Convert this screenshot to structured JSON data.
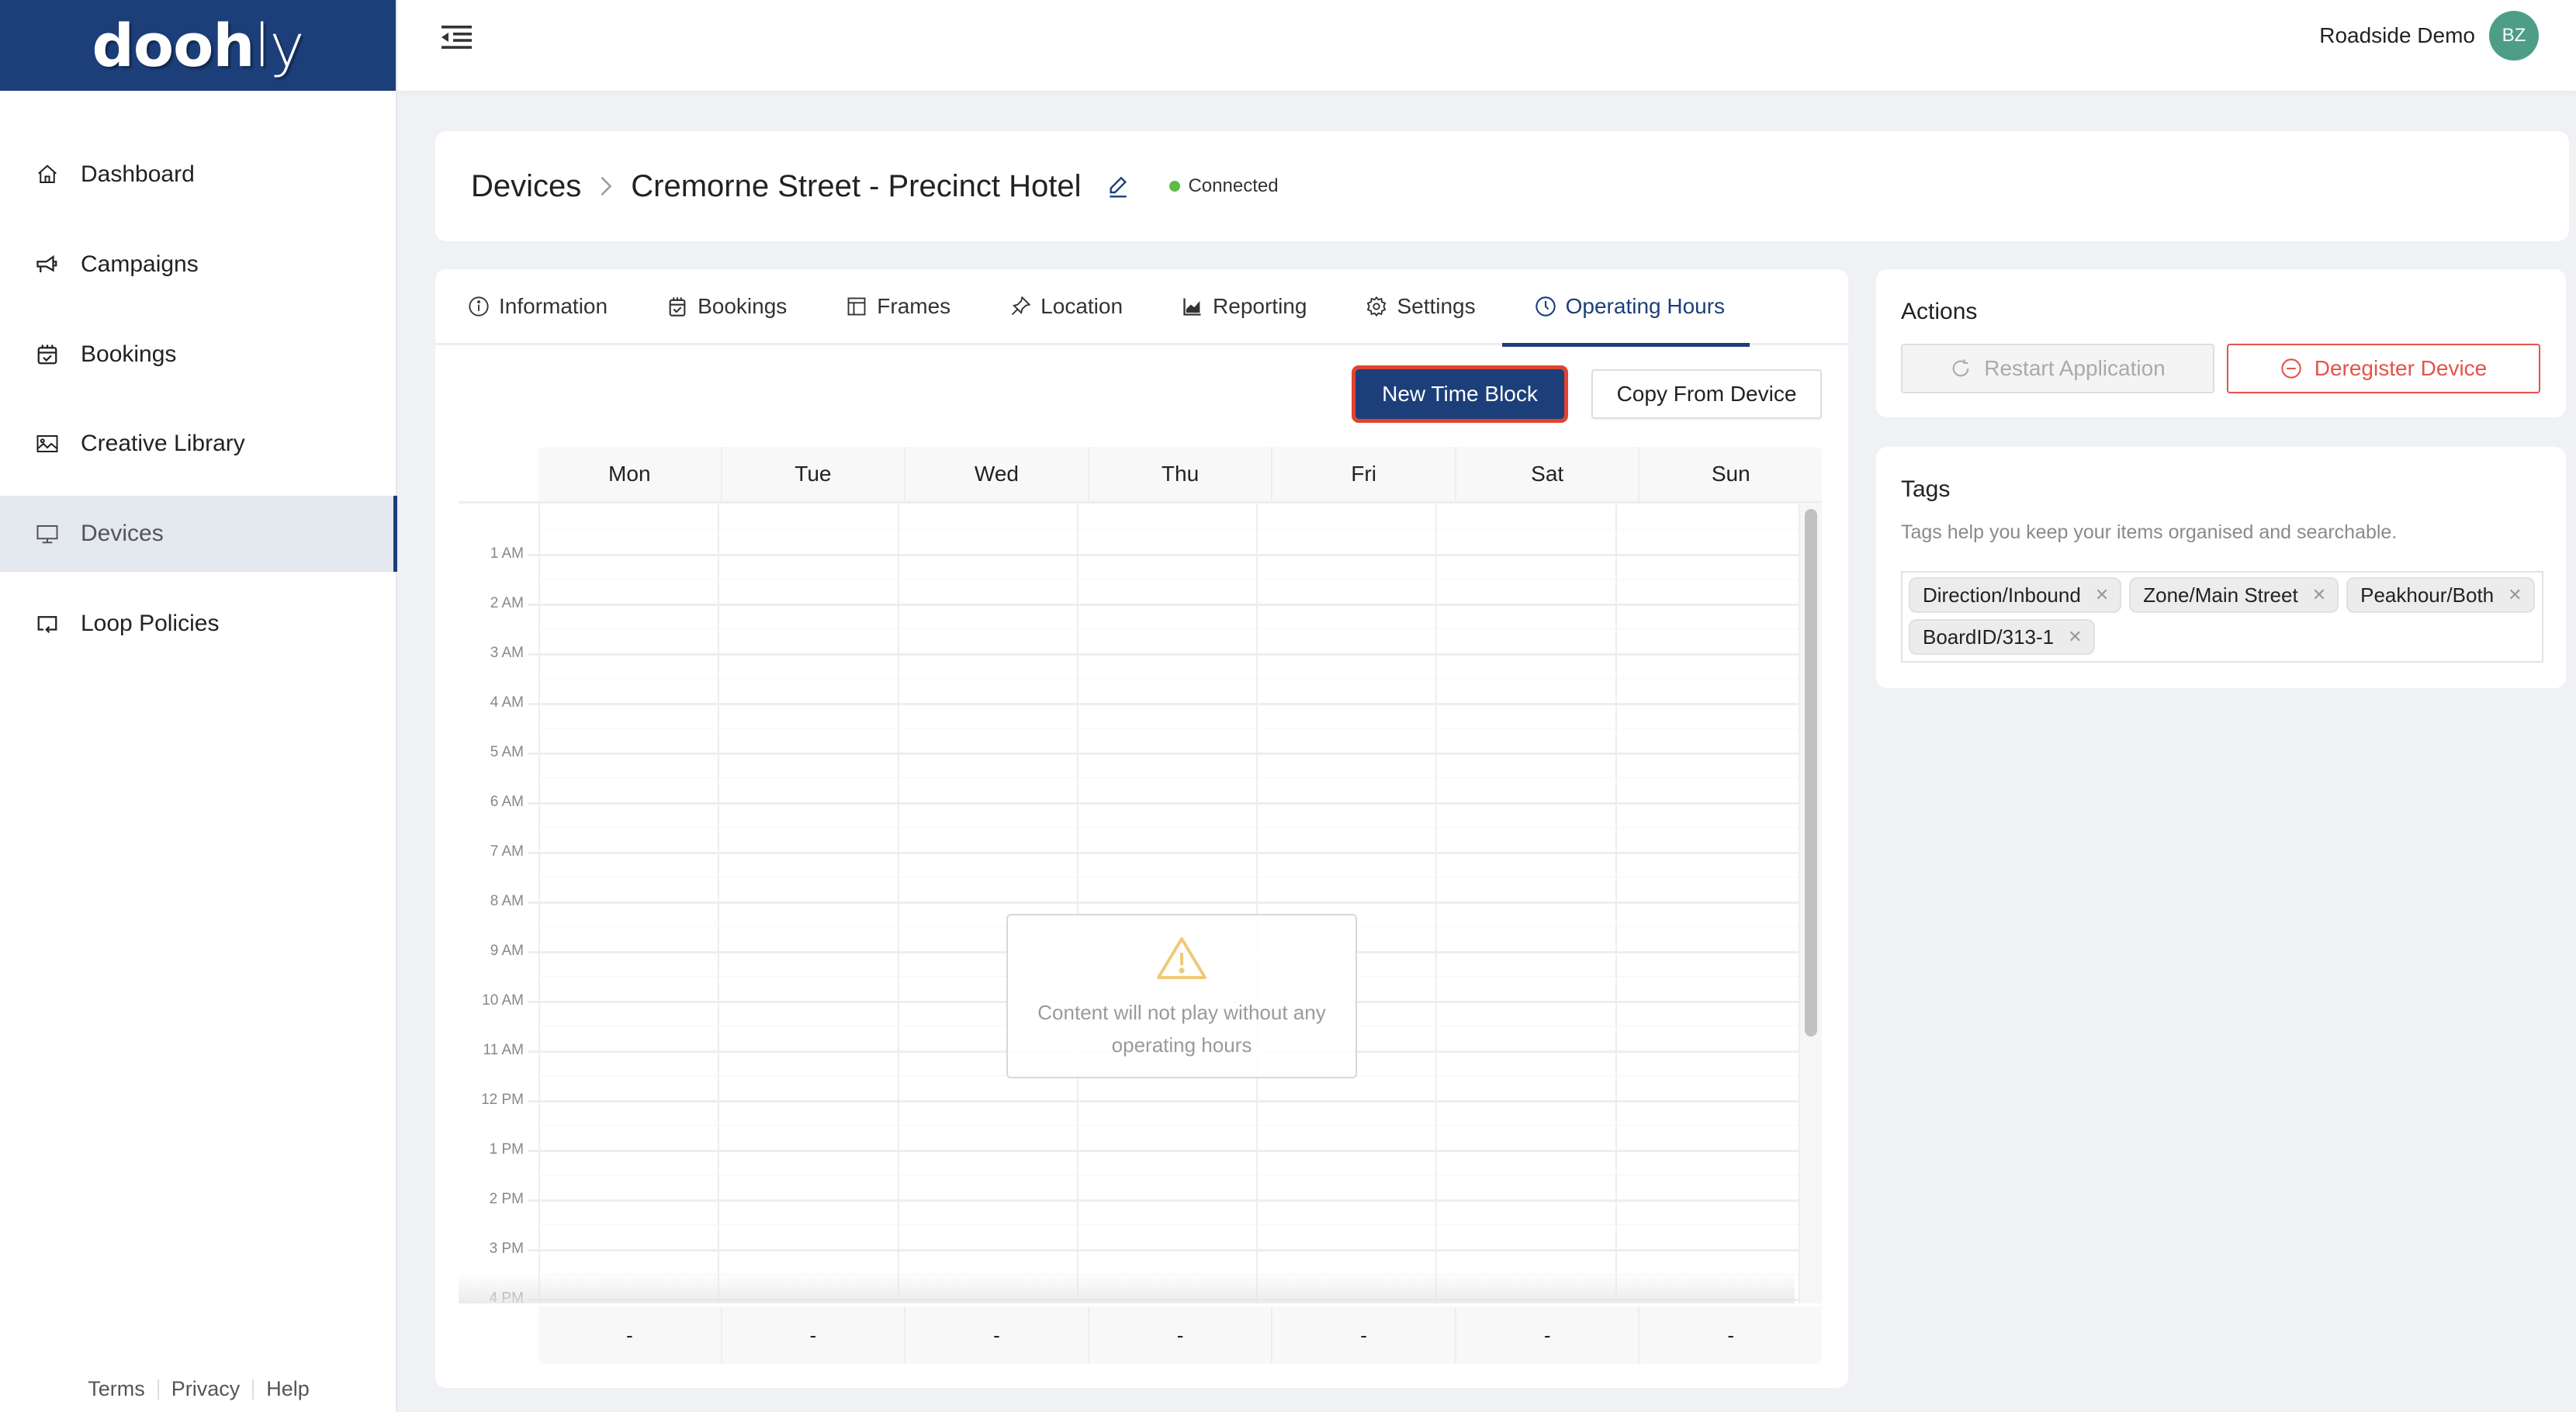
{
  "app": {
    "logo_bold": "dooh",
    "logo_light": "ly"
  },
  "sidebar": {
    "items": [
      {
        "label": "Dashboard",
        "icon": "home-icon",
        "active": false
      },
      {
        "label": "Campaigns",
        "icon": "megaphone-icon",
        "active": false
      },
      {
        "label": "Bookings",
        "icon": "calendar-check-icon",
        "active": false
      },
      {
        "label": "Creative Library",
        "icon": "image-icon",
        "active": false
      },
      {
        "label": "Devices",
        "icon": "monitor-icon",
        "active": true
      },
      {
        "label": "Loop Policies",
        "icon": "loop-icon",
        "active": false
      }
    ],
    "footer": {
      "terms": "Terms",
      "privacy": "Privacy",
      "help": "Help"
    }
  },
  "header": {
    "user_name": "Roadside Demo",
    "avatar_initials": "BZ",
    "avatar_color": "#4e9e87"
  },
  "page": {
    "breadcrumb_root": "Devices",
    "device_name": "Cremorne Street - Precinct Hotel",
    "status": "Connected",
    "status_color": "#5dbb46"
  },
  "tabs": [
    {
      "label": "Information",
      "icon": "info-icon",
      "active": false
    },
    {
      "label": "Bookings",
      "icon": "calendar-check-icon",
      "active": false
    },
    {
      "label": "Frames",
      "icon": "frames-icon",
      "active": false
    },
    {
      "label": "Location",
      "icon": "pin-icon",
      "active": false
    },
    {
      "label": "Reporting",
      "icon": "chart-icon",
      "active": false
    },
    {
      "label": "Settings",
      "icon": "gear-icon",
      "active": false
    },
    {
      "label": "Operating Hours",
      "icon": "clock-icon",
      "active": true
    }
  ],
  "toolbar": {
    "new_time_block": "New Time Block",
    "copy_from_device": "Copy From Device"
  },
  "calendar": {
    "days": [
      "Mon",
      "Tue",
      "Wed",
      "Thu",
      "Fri",
      "Sat",
      "Sun"
    ],
    "hours": [
      "1 AM",
      "2 AM",
      "3 AM",
      "4 AM",
      "5 AM",
      "6 AM",
      "7 AM",
      "8 AM",
      "9 AM",
      "10 AM",
      "11 AM",
      "12 PM",
      "1 PM",
      "2 PM",
      "3 PM",
      "4 PM"
    ],
    "totals": [
      "-",
      "-",
      "-",
      "-",
      "-",
      "-",
      "-"
    ],
    "empty_message": "Content will not play without any operating hours"
  },
  "actions": {
    "title": "Actions",
    "restart": "Restart Application",
    "deregister": "Deregister Device"
  },
  "tags": {
    "title": "Tags",
    "help": "Tags help you keep your items organised and searchable.",
    "items": [
      "Direction/Inbound",
      "Zone/Main Street",
      "Peakhour/Both",
      "BoardID/313-1"
    ]
  },
  "colors": {
    "brand": "#1c3f7a",
    "danger": "#e5534b",
    "warning": "#f0c978"
  }
}
